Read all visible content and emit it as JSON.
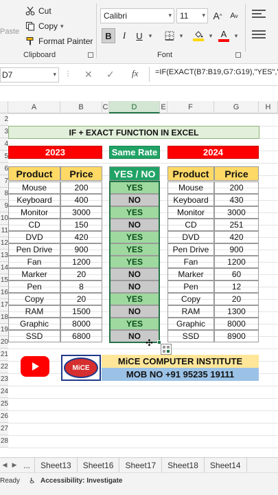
{
  "ribbon": {
    "clipboard": {
      "paste_label": "Paste",
      "cut_label": "Cut",
      "copy_label": "Copy",
      "format_painter_label": "Format Painter",
      "group_label": "Clipboard"
    },
    "font": {
      "font_name": "Calibri",
      "font_size": "11",
      "bold_label": "B",
      "italic_label": "I",
      "underline_label": "U",
      "grow_label": "A",
      "shrink_label": "A",
      "font_color_label": "A",
      "group_label": "Font"
    }
  },
  "formula_bar": {
    "name_box": "D7",
    "fx_label": "fx",
    "formula": "=IF(EXACT(B7:B19,G7:G19),\"YES\",\"NO\")"
  },
  "columns": [
    "A",
    "B",
    "C",
    "D",
    "E",
    "F",
    "G",
    "H"
  ],
  "rows": [
    "2",
    "3",
    "4",
    "5",
    "6",
    "7",
    "8",
    "9",
    "10",
    "11",
    "12",
    "13",
    "14",
    "15",
    "16",
    "17",
    "18",
    "19",
    "20",
    "21",
    "22",
    "23",
    "24",
    "25",
    "26",
    "27",
    "28"
  ],
  "sheet": {
    "title": "IF + EXACT FUNCTION IN EXCEL",
    "label_2023": "2023",
    "label_same_rate": "Same Rate",
    "label_2024": "2024",
    "left_headers": [
      "Product",
      "Price"
    ],
    "result_header": "YES / NO",
    "right_headers": [
      "Product",
      "Price"
    ],
    "rows": [
      {
        "product": "Mouse",
        "price": "200",
        "result": "YES",
        "product2": "Mouse",
        "price2": "200"
      },
      {
        "product": "Keyboard",
        "price": "400",
        "result": "NO",
        "product2": "Keyboard",
        "price2": "430"
      },
      {
        "product": "Monitor",
        "price": "3000",
        "result": "YES",
        "product2": "Monitor",
        "price2": "3000"
      },
      {
        "product": "CD",
        "price": "150",
        "result": "NO",
        "product2": "CD",
        "price2": "251"
      },
      {
        "product": "DVD",
        "price": "420",
        "result": "YES",
        "product2": "DVD",
        "price2": "420"
      },
      {
        "product": "Pen Drive",
        "price": "900",
        "result": "YES",
        "product2": "Pen Drive",
        "price2": "900"
      },
      {
        "product": "Fan",
        "price": "1200",
        "result": "YES",
        "product2": "Fan",
        "price2": "1200"
      },
      {
        "product": "Marker",
        "price": "20",
        "result": "NO",
        "product2": "Marker",
        "price2": "60"
      },
      {
        "product": "Pen",
        "price": "8",
        "result": "NO",
        "product2": "Pen",
        "price2": "12"
      },
      {
        "product": "Copy",
        "price": "20",
        "result": "YES",
        "product2": "Copy",
        "price2": "20"
      },
      {
        "product": "RAM",
        "price": "1500",
        "result": "NO",
        "product2": "RAM",
        "price2": "1300"
      },
      {
        "product": "Graphic",
        "price": "8000",
        "result": "YES",
        "product2": "Graphic",
        "price2": "8000"
      },
      {
        "product": "SSD",
        "price": "6800",
        "result": "NO",
        "product2": "SSD",
        "price2": "8900"
      }
    ]
  },
  "institute": {
    "logo_text": "MiCE",
    "name": "MiCE COMPUTER INSTITUTE",
    "mobile": "MOB NO +91 95235 19111"
  },
  "sheet_tabs": {
    "ellipsis": "...",
    "tabs": [
      "Sheet13",
      "Sheet16",
      "Sheet17",
      "Sheet18",
      "Sheet14"
    ]
  },
  "status_bar": {
    "ready": "Ready",
    "accessibility": "Accessibility: Investigate"
  },
  "colors": {
    "excel_green": "#217346",
    "yes_fill": "#9fd99f",
    "no_fill": "#c9c9c9",
    "header_yellow": "#ffd966",
    "band_red": "#ff0000",
    "title_fill": "#e2efda"
  },
  "icons": [
    "scissors-icon",
    "copy-icon",
    "format-painter-icon",
    "paste-icon",
    "borders-icon",
    "fill-color-icon",
    "font-color-icon",
    "cancel-icon",
    "enter-icon",
    "youtube-icon",
    "quick-analysis-icon"
  ]
}
